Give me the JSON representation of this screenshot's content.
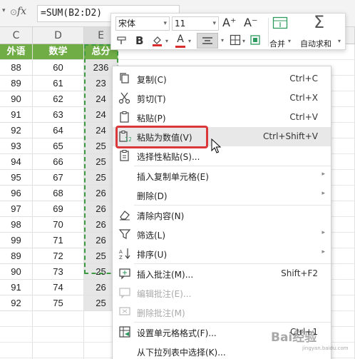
{
  "formula_bar": {
    "fx_label": "fx",
    "formula": "=SUM(B2:D2)"
  },
  "columns": [
    {
      "letter": "C",
      "selected": false
    },
    {
      "letter": "D",
      "selected": false
    },
    {
      "letter": "E",
      "selected": true
    }
  ],
  "sheet_headers": [
    "外语",
    "数学",
    "总分"
  ],
  "rows": [
    [
      "88",
      "60",
      "236"
    ],
    [
      "89",
      "61",
      "23"
    ],
    [
      "90",
      "62",
      "24"
    ],
    [
      "91",
      "63",
      "24"
    ],
    [
      "92",
      "64",
      "24"
    ],
    [
      "93",
      "65",
      "25"
    ],
    [
      "94",
      "66",
      "25"
    ],
    [
      "95",
      "67",
      "25"
    ],
    [
      "96",
      "68",
      "26"
    ],
    [
      "97",
      "69",
      "26"
    ],
    [
      "98",
      "70",
      "26"
    ],
    [
      "99",
      "71",
      "26"
    ],
    [
      "89",
      "72",
      "25"
    ],
    [
      "90",
      "73",
      "25"
    ],
    [
      "91",
      "74",
      "26"
    ],
    [
      "92",
      "75",
      "25"
    ]
  ],
  "mini_toolbar": {
    "font_name": "宋体",
    "font_size": "11",
    "increase_font_label": "A⁺",
    "decrease_font_label": "A⁻",
    "bold_label": "B",
    "font_color_label": "A",
    "merge_label": "合并",
    "autosum_label": "自动求和",
    "sigma_label": "Σ",
    "accent_color": "#2e9b5f",
    "font_color": "#d92d2d"
  },
  "context_menu": {
    "items": [
      {
        "label": "复制(C)",
        "shortcut": "Ctrl+C",
        "icon": "copy-icon",
        "disabled": false,
        "submenu": false,
        "hover": false
      },
      {
        "label": "剪切(T)",
        "shortcut": "Ctrl+X",
        "icon": "scissors-icon",
        "disabled": false,
        "submenu": false,
        "hover": false
      },
      {
        "label": "粘贴(P)",
        "shortcut": "Ctrl+V",
        "icon": "paste-icon",
        "disabled": false,
        "submenu": false,
        "hover": false
      },
      {
        "label": "粘贴为数值(V)",
        "shortcut": "Ctrl+Shift+V",
        "icon": "paste-values-icon",
        "disabled": false,
        "submenu": false,
        "hover": true
      },
      {
        "label": "选择性粘贴(S)...",
        "shortcut": "",
        "icon": "paste-special-icon",
        "disabled": false,
        "submenu": false,
        "hover": false
      },
      {
        "label": "插入复制单元格(E)",
        "shortcut": "",
        "icon": "",
        "disabled": false,
        "submenu": true,
        "hover": false
      },
      {
        "label": "删除(D)",
        "shortcut": "",
        "icon": "",
        "disabled": false,
        "submenu": true,
        "hover": false
      },
      {
        "label": "清除内容(N)",
        "shortcut": "",
        "icon": "eraser-icon",
        "disabled": false,
        "submenu": false,
        "hover": false
      },
      {
        "label": "筛选(L)",
        "shortcut": "",
        "icon": "filter-icon",
        "disabled": false,
        "submenu": true,
        "hover": false
      },
      {
        "label": "排序(U)",
        "shortcut": "",
        "icon": "sort-icon",
        "disabled": false,
        "submenu": true,
        "hover": false
      },
      {
        "label": "插入批注(M)...",
        "shortcut": "Shift+F2",
        "icon": "comment-icon",
        "disabled": false,
        "submenu": false,
        "hover": false
      },
      {
        "label": "编辑批注(E)...",
        "shortcut": "",
        "icon": "edit-comment-icon",
        "disabled": true,
        "submenu": false,
        "hover": false
      },
      {
        "label": "删除批注(M)",
        "shortcut": "",
        "icon": "delete-comment-icon",
        "disabled": true,
        "submenu": false,
        "hover": false
      },
      {
        "label": "设置单元格格式(F)...",
        "shortcut": "Ctrl+1",
        "icon": "format-cells-icon",
        "disabled": false,
        "submenu": false,
        "hover": false
      },
      {
        "label": "从下拉列表中选择(K)...",
        "shortcut": "",
        "icon": "",
        "disabled": false,
        "submenu": false,
        "hover": false
      }
    ]
  },
  "watermark": {
    "text": "Bai经验",
    "sub": "jingyan.baidu.com"
  }
}
